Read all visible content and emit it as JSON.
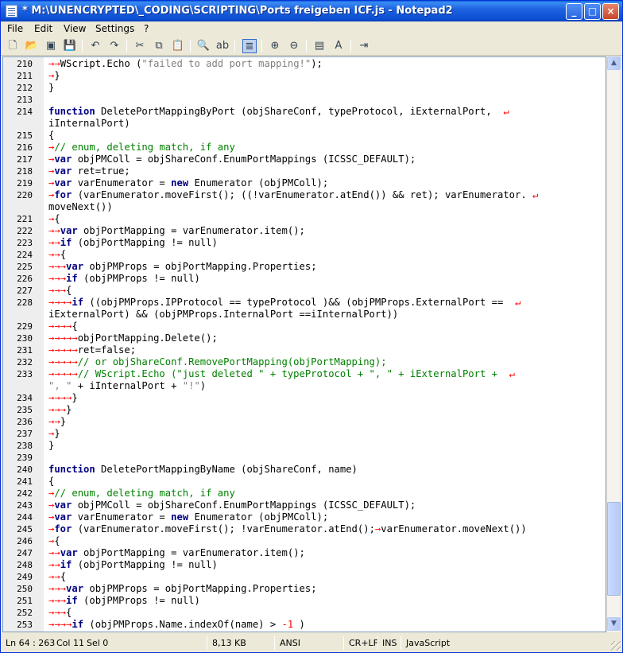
{
  "window": {
    "title": "* M:\\UNENCRYPTED\\_CODING\\SCRIPTING\\Ports freigeben ICF.js - Notepad2",
    "min": "_",
    "max": "□",
    "close": "×"
  },
  "menu": [
    "File",
    "Edit",
    "View",
    "Settings",
    "?"
  ],
  "lines": [
    {
      "n": "210",
      "t": "→→WScript.Echo (\"failed to add port mapping!\");"
    },
    {
      "n": "211",
      "t": "→}"
    },
    {
      "n": "212",
      "t": "}"
    },
    {
      "n": "213",
      "t": ""
    },
    {
      "n": "214",
      "t": "function DeletePortMappingByPort (objShareConf, typeProtocol, iExternalPort, ↵"
    },
    {
      "n": "",
      "t": "iInternalPort)"
    },
    {
      "n": "215",
      "t": "{"
    },
    {
      "n": "216",
      "t": "→// enum, deleting match, if any"
    },
    {
      "n": "217",
      "t": "→var objPMColl = objShareConf.EnumPortMappings (ICSSC_DEFAULT);"
    },
    {
      "n": "218",
      "t": "→var ret=true;"
    },
    {
      "n": "219",
      "t": "→var varEnumerator = new Enumerator (objPMColl);"
    },
    {
      "n": "220",
      "t": "→for (varEnumerator.moveFirst(); ((!varEnumerator.atEnd()) && ret); varEnumerator.↵"
    },
    {
      "n": "",
      "t": "moveNext())"
    },
    {
      "n": "221",
      "t": "→{"
    },
    {
      "n": "222",
      "t": "→→var objPortMapping = varEnumerator.item();"
    },
    {
      "n": "223",
      "t": "→→if (objPortMapping != null)"
    },
    {
      "n": "224",
      "t": "→→{"
    },
    {
      "n": "225",
      "t": "→→→var objPMProps = objPortMapping.Properties;"
    },
    {
      "n": "226",
      "t": "→→→if (objPMProps != null)"
    },
    {
      "n": "227",
      "t": "→→→{"
    },
    {
      "n": "228",
      "t": "→→→→if ((objPMProps.IPProtocol == typeProtocol )&& (objPMProps.ExternalPort == ↵"
    },
    {
      "n": "",
      "t": "iExternalPort) && (objPMProps.InternalPort ==iInternalPort))"
    },
    {
      "n": "229",
      "t": "→→→→{"
    },
    {
      "n": "230",
      "t": "→→→→→objPortMapping.Delete();"
    },
    {
      "n": "231",
      "t": "→→→→→ret=false;"
    },
    {
      "n": "232",
      "t": "→→→→→// or objShareConf.RemovePortMapping(objPortMapping);"
    },
    {
      "n": "233",
      "t": "→→→→→// WScript.Echo (\"just deleted \" + typeProtocol + \", \" + iExternalPort + ↵"
    },
    {
      "n": "",
      "t": "\", \" + iInternalPort + \"!\")"
    },
    {
      "n": "234",
      "t": "→→→→}"
    },
    {
      "n": "235",
      "t": "→→→}"
    },
    {
      "n": "236",
      "t": "→→}"
    },
    {
      "n": "237",
      "t": "→}"
    },
    {
      "n": "238",
      "t": "}"
    },
    {
      "n": "239",
      "t": ""
    },
    {
      "n": "240",
      "t": "function DeletePortMappingByName (objShareConf, name)"
    },
    {
      "n": "241",
      "t": "{"
    },
    {
      "n": "242",
      "t": "→// enum, deleting match, if any"
    },
    {
      "n": "243",
      "t": "→var objPMColl = objShareConf.EnumPortMappings (ICSSC_DEFAULT);"
    },
    {
      "n": "244",
      "t": "→var varEnumerator = new Enumerator (objPMColl);"
    },
    {
      "n": "245",
      "t": "→for (varEnumerator.moveFirst(); !varEnumerator.atEnd();→varEnumerator.moveNext())"
    },
    {
      "n": "246",
      "t": "→{"
    },
    {
      "n": "247",
      "t": "→→var objPortMapping = varEnumerator.item();"
    },
    {
      "n": "248",
      "t": "→→if (objPortMapping != null)"
    },
    {
      "n": "249",
      "t": "→→{"
    },
    {
      "n": "250",
      "t": "→→→var objPMProps = objPortMapping.Properties;"
    },
    {
      "n": "251",
      "t": "→→→if (objPMProps != null)"
    },
    {
      "n": "252",
      "t": "→→→{"
    },
    {
      "n": "253",
      "t": "→→→→if (objPMProps.Name.indexOf(name) > -1 )"
    }
  ],
  "status": {
    "position": "Ln 64 : 263",
    "col": "Col 11",
    "sel": "Sel 0",
    "size": "8,13 KB",
    "encoding": "ANSI",
    "eol": "CR+LF",
    "mode": "INS",
    "lexer": "JavaScript"
  },
  "icons": [
    "new-icon",
    "open-icon",
    "browse-icon",
    "save-icon",
    "undo-icon",
    "redo-icon",
    "cut-icon",
    "copy-icon",
    "paste-icon",
    "find-icon",
    "replace-icon",
    "word-wrap-icon",
    "zoom-in-icon",
    "zoom-out-icon",
    "scheme-icon",
    "font-icon",
    "exit-icon"
  ]
}
